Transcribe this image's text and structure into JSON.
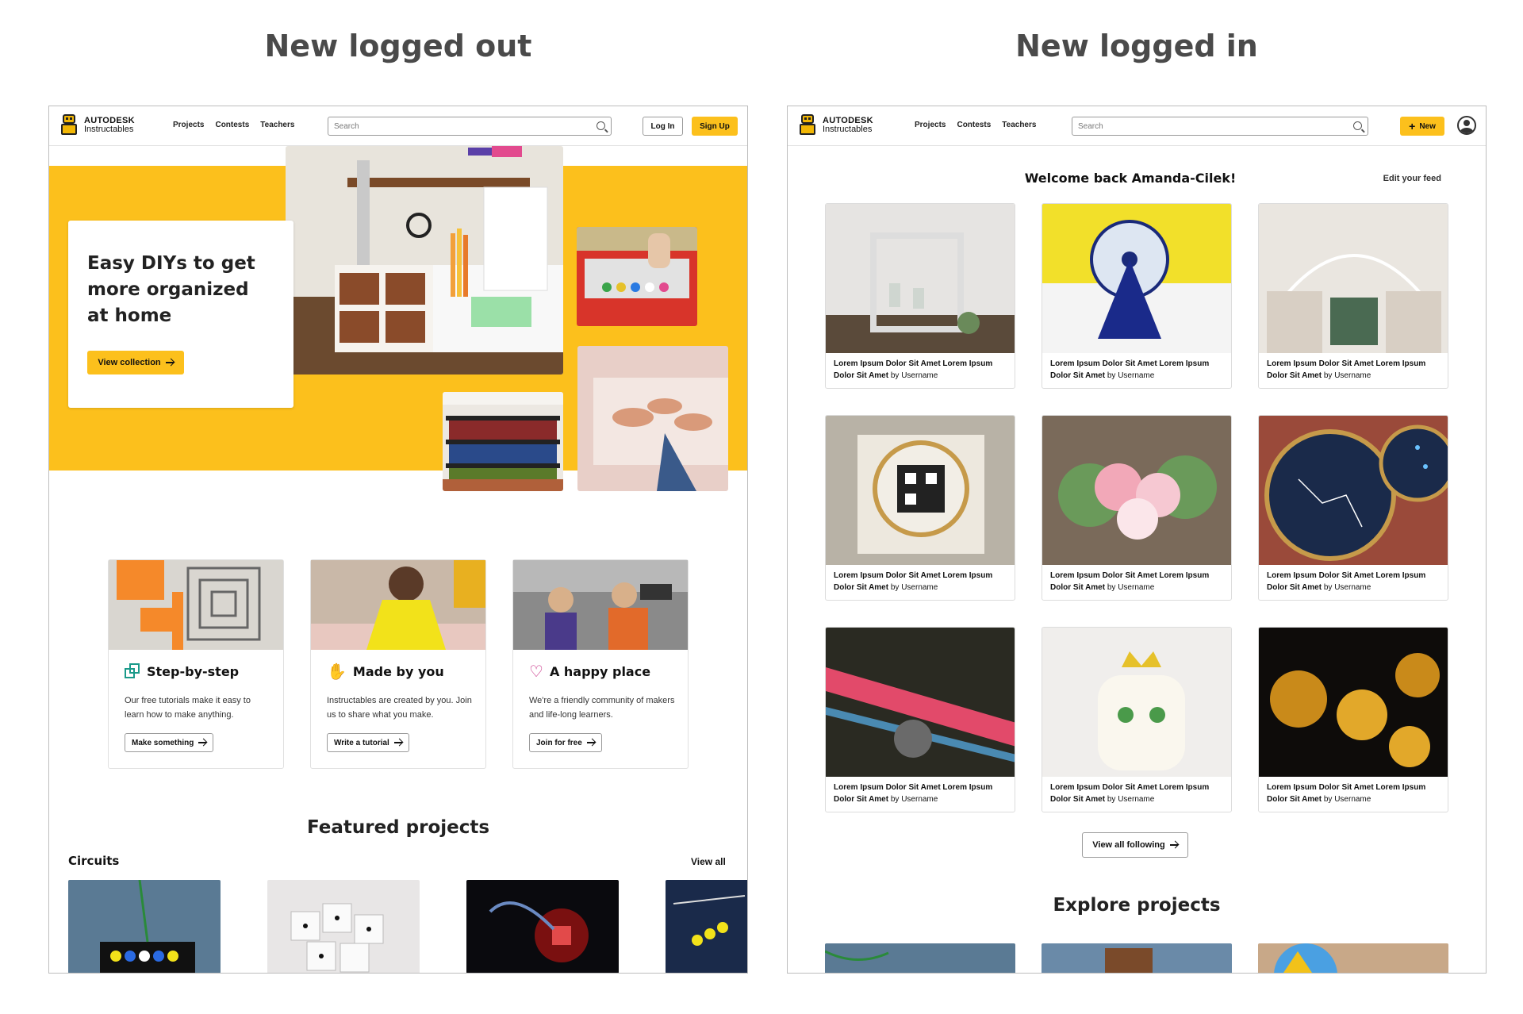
{
  "headings": {
    "logged_out": "New logged out",
    "logged_in": "New logged in"
  },
  "brand": {
    "name": "AUTODESK",
    "sub": "Instructables"
  },
  "nav": {
    "links": [
      "Projects",
      "Contests",
      "Teachers"
    ],
    "search_placeholder": "Search"
  },
  "logged_out": {
    "login": "Log In",
    "signup": "Sign Up",
    "hero": {
      "title": "Easy DIYs to get more organized at home",
      "button": "View collection"
    },
    "features": [
      {
        "title": "Step-by-step",
        "desc": "Our free tutorials make it easy to learn how to make anything.",
        "button": "Make something"
      },
      {
        "title": "Made by you",
        "desc": "Instructables are created by you. Join us to share what you make.",
        "button": "Write a tutorial"
      },
      {
        "title": "A happy place",
        "desc": "We're a friendly community of makers and life-long learners.",
        "button": "Join for free"
      }
    ],
    "featured_title": "Featured projects",
    "row_label": "Circuits",
    "view_all": "View all"
  },
  "logged_in": {
    "new_button": "New",
    "welcome": "Welcome back Amanda-Cilek!",
    "edit_feed": "Edit your feed",
    "card_title": "Lorem Ipsum Dolor Sit Amet Lorem Ipsum Dolor Sit Amet",
    "card_by": "by Username",
    "view_following": "View all following",
    "explore_title": "Explore projects"
  },
  "colors": {
    "accent": "#fcc01c",
    "text": "#111111",
    "heading": "#4a4a4a"
  }
}
